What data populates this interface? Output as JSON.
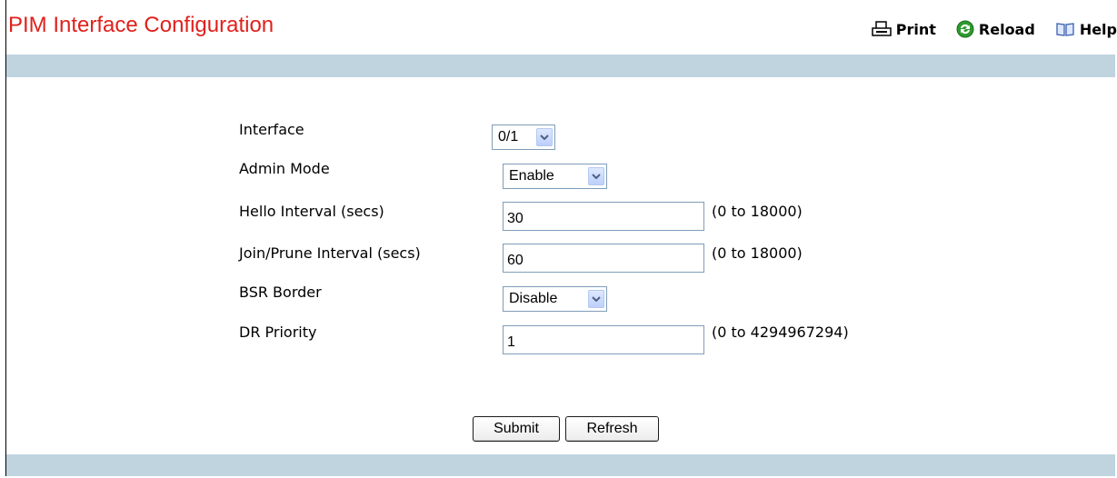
{
  "header": {
    "title": "PIM Interface Configuration",
    "print_label": "Print",
    "reload_label": "Reload",
    "help_label": "Help"
  },
  "form": {
    "interface": {
      "label": "Interface",
      "value": "0/1"
    },
    "admin_mode": {
      "label": "Admin Mode",
      "value": "Enable"
    },
    "hello_interval": {
      "label": "Hello Interval (secs)",
      "value": "30",
      "range": "(0 to 18000)"
    },
    "join_prune_interval": {
      "label": "Join/Prune Interval (secs)",
      "value": "60",
      "range": "(0 to 18000)"
    },
    "bsr_border": {
      "label": "BSR Border",
      "value": "Disable"
    },
    "dr_priority": {
      "label": "DR Priority",
      "value": "1",
      "range": "(0 to 4294967294)"
    }
  },
  "buttons": {
    "submit": "Submit",
    "refresh": "Refresh"
  },
  "colors": {
    "title": "#e0211c",
    "band": "#c0d4e0",
    "reload_icon": "#2e9a2e"
  },
  "icons": {
    "print": "printer-icon",
    "reload": "reload-icon",
    "help": "book-icon",
    "dropdown": "chevron-down-icon"
  }
}
